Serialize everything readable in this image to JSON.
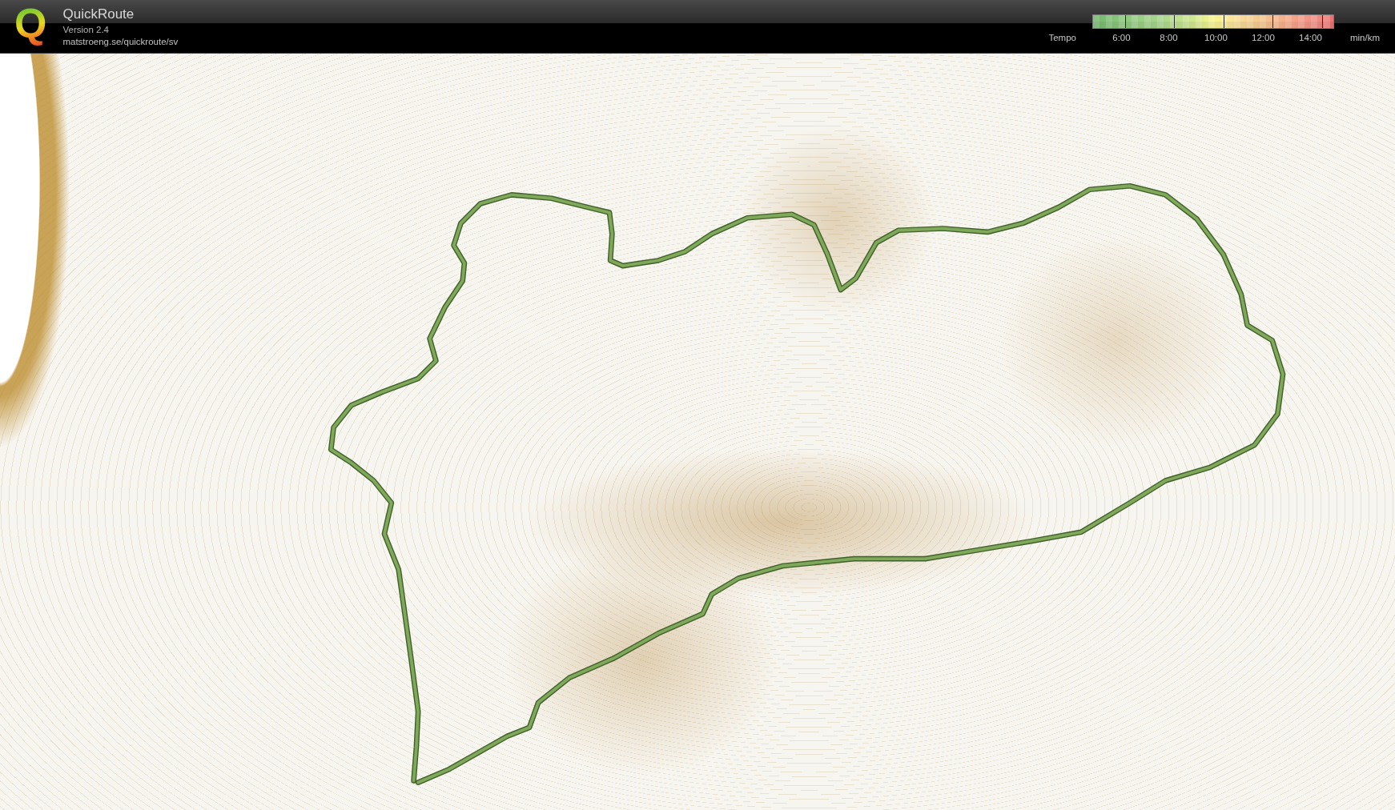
{
  "app": {
    "logo": "Q",
    "title": "QuickRoute",
    "version": "Version 2.4",
    "url": "matstroeng.se/quickroute/sv"
  },
  "legend": {
    "label": "Tempo",
    "ticks": [
      "6:00",
      "8:00",
      "10:00",
      "12:00",
      "14:00"
    ],
    "unit": "min/km"
  }
}
